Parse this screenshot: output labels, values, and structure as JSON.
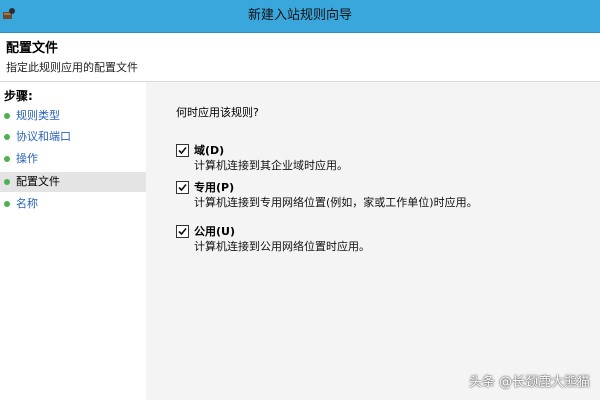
{
  "window": {
    "title": "新建入站规则向导"
  },
  "header": {
    "title": "配置文件",
    "subtitle": "指定此规则应用的配置文件"
  },
  "steps": {
    "label": "步骤:",
    "items": [
      {
        "label": "规则类型"
      },
      {
        "label": "协议和端口"
      },
      {
        "label": "操作"
      },
      {
        "label": "配置文件"
      },
      {
        "label": "名称"
      }
    ]
  },
  "content": {
    "question": "何时应用该规则?",
    "options": [
      {
        "title": "域(D)",
        "description": "计算机连接到其企业域时应用。",
        "checked": true
      },
      {
        "title": "专用(P)",
        "description": "计算机连接到专用网络位置(例如，家或工作单位)时应用。",
        "checked": true
      },
      {
        "title": "公用(U)",
        "description": "计算机连接到公用网络位置时应用。",
        "checked": true
      }
    ]
  },
  "watermark": "头条 @长颈鹿大熊猫",
  "colors": {
    "titlebar": "#3aa7dc",
    "step_dot": "#4fb04f",
    "step_link": "#2a63b8",
    "content_bg": "#f4f4f4",
    "current_step_bg": "#e4e4e4"
  },
  "icons": {
    "window": "firewall-window-icon",
    "step": "green-dot-icon",
    "checkbox": "checkmark-icon"
  }
}
